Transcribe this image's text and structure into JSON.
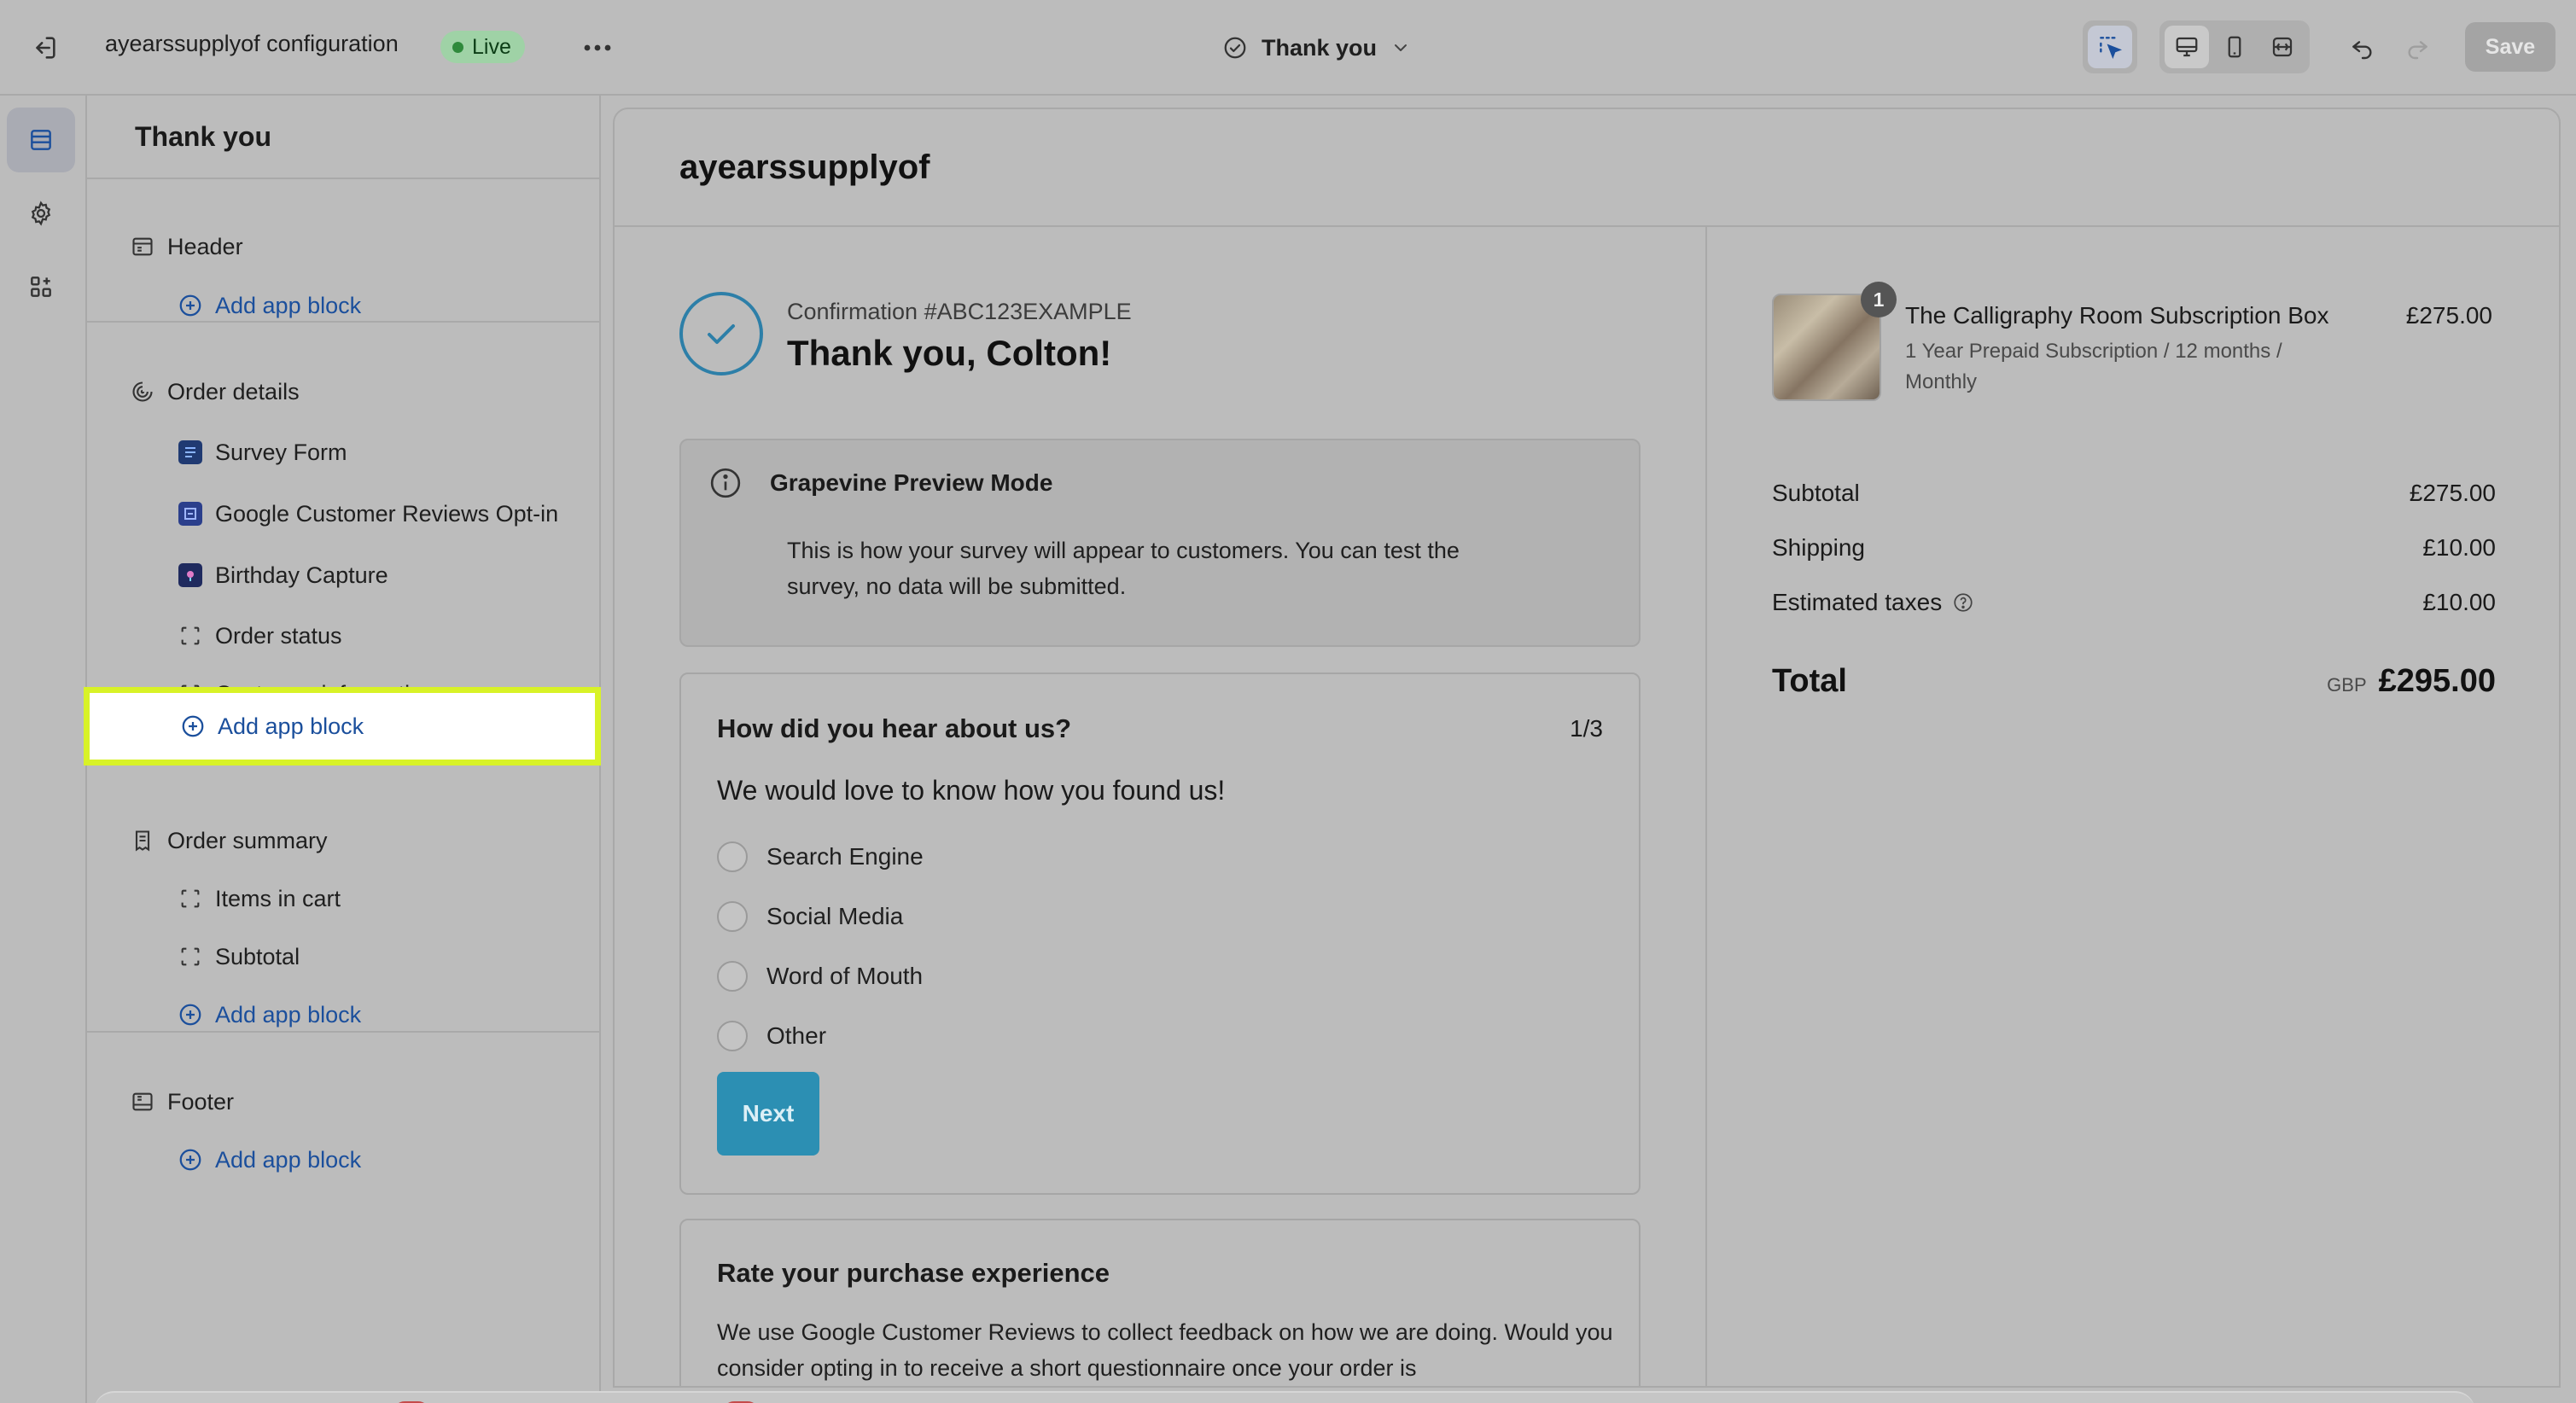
{
  "topbar": {
    "app_title": "ayearssupplyof configuration",
    "live_label": "Live",
    "page_name": "Thank you",
    "save_label": "Save",
    "icons": {
      "exit": "exit-icon",
      "more": "more-horizontal-icon",
      "page_check": "check-circle-icon",
      "chevron": "chevron-down-icon",
      "inspector": "select-pointer-icon",
      "desktop": "desktop-icon",
      "mobile": "mobile-icon",
      "fullwidth": "fullwidth-icon",
      "undo": "undo-icon",
      "redo": "redo-icon"
    }
  },
  "rail": {
    "items": [
      {
        "icon": "sections-icon",
        "active": true
      },
      {
        "icon": "settings-gear-icon",
        "active": false
      },
      {
        "icon": "apps-icon",
        "active": false
      }
    ]
  },
  "sidebar": {
    "title": "Thank you",
    "sections": [
      {
        "label": "Header",
        "icon": "header-layout-icon",
        "items": [],
        "add_label": "Add app block"
      },
      {
        "label": "Order details",
        "icon": "order-details-icon",
        "items": [
          {
            "label": "Survey Form",
            "icon": "survey-app-icon",
            "kind": "app"
          },
          {
            "label": "Google Customer Reviews Opt-in",
            "icon": "google-reviews-app-icon",
            "kind": "app"
          },
          {
            "label": "Birthday Capture",
            "icon": "birthday-app-icon",
            "kind": "app"
          },
          {
            "label": "Order status",
            "icon": "block-icon",
            "kind": "block"
          },
          {
            "label": "Customer information",
            "icon": "block-icon",
            "kind": "block"
          }
        ],
        "add_label": "Add app block"
      },
      {
        "label": "Order summary",
        "icon": "receipt-icon",
        "items": [
          {
            "label": "Items in cart",
            "icon": "block-icon",
            "kind": "block"
          },
          {
            "label": "Subtotal",
            "icon": "block-icon",
            "kind": "block"
          }
        ],
        "add_label": "Add app block"
      },
      {
        "label": "Footer",
        "icon": "footer-layout-icon",
        "items": [],
        "add_label": "Add app block"
      }
    ]
  },
  "preview": {
    "store_name": "ayearssupplyof",
    "confirmation_number": "Confirmation #ABC123EXAMPLE",
    "thanks_heading": "Thank you, Colton!",
    "preview_mode": {
      "title": "Grapevine Preview Mode",
      "body": "This is how your survey will appear to customers. You can test the survey, no data will be submitted."
    },
    "survey": {
      "question": "How did you hear about us?",
      "step": "1/3",
      "subtitle": "We would love to know how you found us!",
      "options": [
        "Search Engine",
        "Social Media",
        "Word of Mouth",
        "Other"
      ],
      "next_label": "Next"
    },
    "rate": {
      "title": "Rate your purchase experience",
      "body": "We use Google Customer Reviews to collect feedback on how we are doing. Would you consider opting in to receive a short questionnaire once your order is"
    }
  },
  "order_summary": {
    "product": {
      "name": "The Calligraphy Room Subscription Box",
      "variant": "1 Year Prepaid Subscription / 12 months / Monthly",
      "price": "£275.00",
      "quantity": "1"
    },
    "subtotal_label": "Subtotal",
    "subtotal_value": "£275.00",
    "shipping_label": "Shipping",
    "shipping_value": "£10.00",
    "taxes_label": "Estimated taxes",
    "taxes_value": "£10.00",
    "total_label": "Total",
    "currency": "GBP",
    "total_value": "£295.00"
  },
  "colors": {
    "link_blue": "#1b4f9c",
    "highlight": "#d8f227",
    "accent_teal": "#2c8fb3",
    "live_green": "#9fd2a6"
  }
}
